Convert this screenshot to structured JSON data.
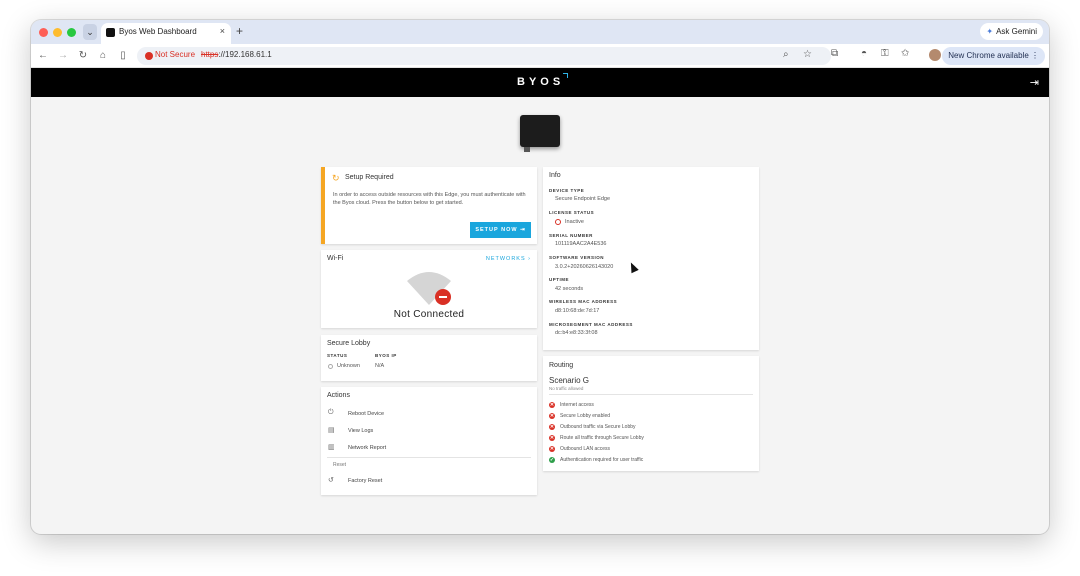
{
  "browser": {
    "tab_title": "Byos Web Dashboard",
    "tab_close": "×",
    "new_tab": "+",
    "gemini_label": "Ask Gemini",
    "security_label": "Not Secure",
    "url_scheme": "https",
    "url_rest": "://192.168.61.1",
    "update_label": "New Chrome available",
    "update_menu": "⋮",
    "nav": {
      "back": "←",
      "forward": "→",
      "reload": "↻",
      "home": "⌂",
      "sidepanel": "▯"
    },
    "omni_icons": {
      "zoom": "⌕",
      "bookmark": "☆"
    },
    "toolbar_icons": {
      "extensions": "⧉",
      "incognito": "◓",
      "passwords": "⚿",
      "star": "✩"
    }
  },
  "app": {
    "logo": "BYOS",
    "logout_icon": "⇥",
    "setup": {
      "title": "Setup Required",
      "icon": "↻",
      "message": "In order to access outside resources with this Edge, you must authenticate with the Byos cloud. Press the button below to get started.",
      "button": "SETUP NOW ⇥"
    },
    "wifi": {
      "title": "Wi-Fi",
      "networks_link": "NETWORKS ›",
      "status": "Not Connected",
      "status_icon": "—"
    },
    "secure_lobby": {
      "title": "Secure Lobby",
      "status_head": "STATUS",
      "ip_head": "BYOS IP",
      "status_val": "Unknown",
      "ip_val": "N/A"
    },
    "actions": {
      "title": "Actions",
      "items": [
        {
          "label": "Reboot Device",
          "icon": "⏻"
        },
        {
          "label": "View Logs",
          "icon": "▤"
        },
        {
          "label": "Network Report",
          "icon": "▥"
        }
      ],
      "reset_head": "Reset",
      "reset_item": {
        "label": "Factory Reset",
        "icon": "↺"
      }
    },
    "info": {
      "title": "Info",
      "fields": [
        {
          "key": "DEVICE TYPE",
          "value": "Secure Endpoint Edge"
        },
        {
          "key": "LICENSE STATUS",
          "value": "Inactive"
        },
        {
          "key": "SERIAL NUMBER",
          "value": "101119AAC2A4E536"
        },
        {
          "key": "SOFTWARE VERSION",
          "value": "3.0.2+20260626143020"
        },
        {
          "key": "UPTIME",
          "value": "42 seconds"
        },
        {
          "key": "WIRELESS MAC ADDRESS",
          "value": "d8:10:68:de:7d:17"
        },
        {
          "key": "MICROSEGMENT MAC ADDRESS",
          "value": "dc:b4:e8:33:3f:08"
        }
      ]
    },
    "routing": {
      "title": "Routing",
      "scenario": "Scenario G",
      "scenario_sub": "No traffic allowed",
      "rules": [
        {
          "label": "Internet access",
          "state": "✕"
        },
        {
          "label": "Secure Lobby enabled",
          "state": "✕"
        },
        {
          "label": "Outbound traffic via Secure Lobby",
          "state": "✕"
        },
        {
          "label": "Route all traffic through Secure Lobby",
          "state": "✕"
        },
        {
          "label": "Outbound LAN access",
          "state": "✕"
        },
        {
          "label": "Authentication required for user traffic",
          "state": "✓"
        }
      ]
    }
  }
}
